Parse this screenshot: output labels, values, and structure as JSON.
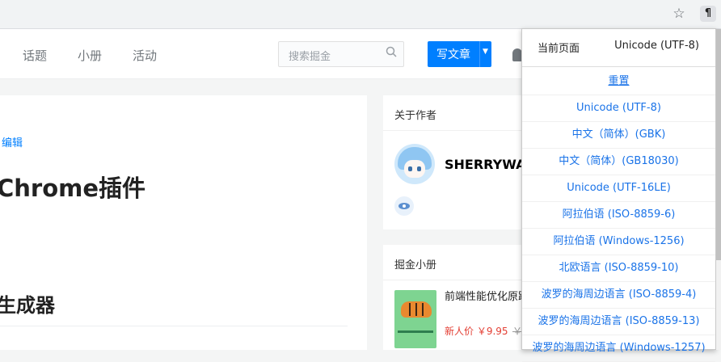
{
  "chrome": {
    "star_glyph": "☆",
    "ext_glyph": "¶"
  },
  "nav": {
    "items": [
      "话题",
      "小册",
      "活动"
    ],
    "search_placeholder": "搜索掘金",
    "write_label": "写文章"
  },
  "article": {
    "edit_link": "编辑",
    "title": "Chrome插件",
    "heading2": "生成器"
  },
  "author": {
    "card_title": "关于作者",
    "name": "SHERRYWA"
  },
  "book": {
    "card_title": "掘金小册",
    "title": "前端性能优化原践",
    "price": "新人价 ￥9.95",
    "old_price": "￥"
  },
  "popup": {
    "current_label": "当前页面",
    "current_value": "Unicode (UTF-8)",
    "items": [
      "重置",
      "Unicode (UTF-8)",
      "中文（简体）(GBK)",
      "中文（简体）(GB18030)",
      "Unicode (UTF-16LE)",
      "阿拉伯语 (ISO-8859-6)",
      "阿拉伯语 (Windows-1256)",
      "北欧语言 (ISO-8859-10)",
      "波罗的海周边语言 (ISO-8859-4)",
      "波罗的海周边语言 (ISO-8859-13)",
      "波罗的海周边语言 (Windows-1257)"
    ]
  },
  "colors": {
    "accent": "#007fff",
    "link": "#1a73e8",
    "price": "#e33e33"
  }
}
